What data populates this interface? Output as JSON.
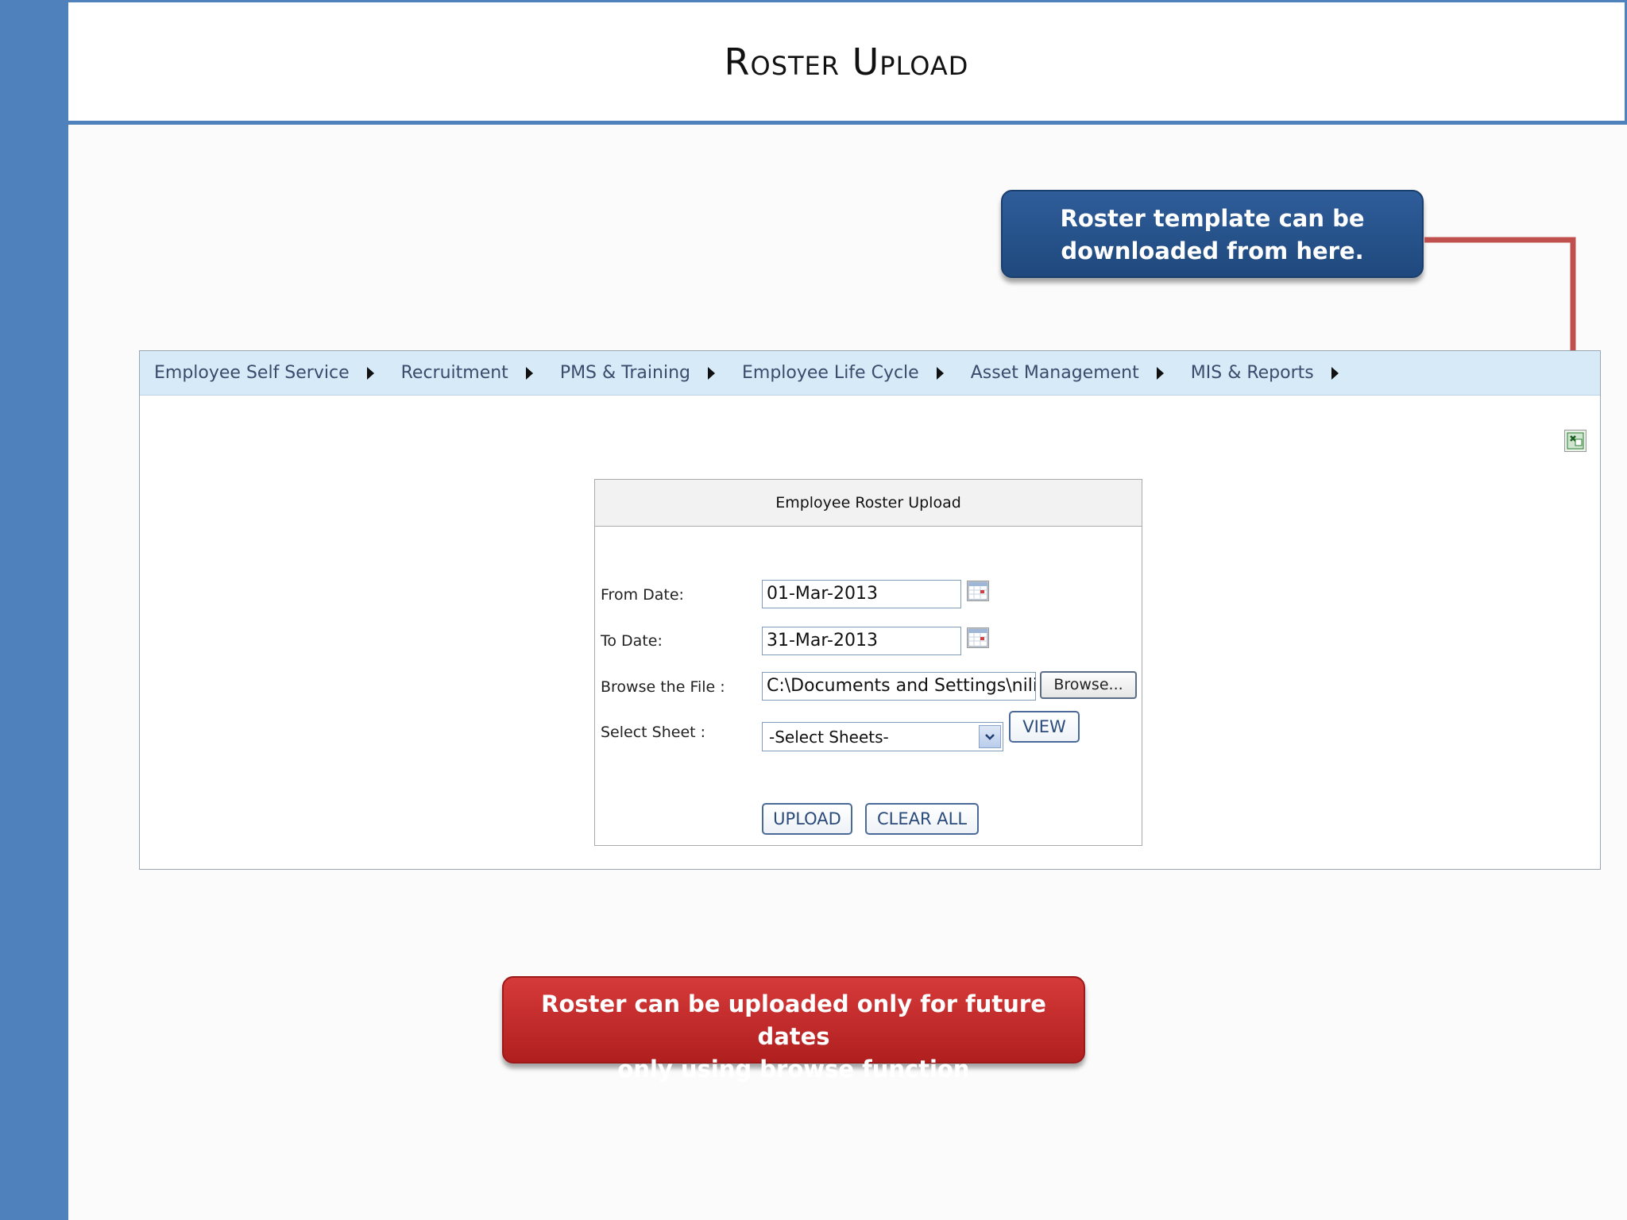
{
  "slide": {
    "title": "Roster Upload"
  },
  "callouts": {
    "template_line1": "Roster template can be",
    "template_line2": "downloaded from here.",
    "future_line1": "Roster can be uploaded only for future dates",
    "future_line2": "only using browse function"
  },
  "menu": {
    "items": [
      {
        "label": "Employee Self Service"
      },
      {
        "label": "Recruitment"
      },
      {
        "label": "PMS & Training"
      },
      {
        "label": "Employee Life Cycle"
      },
      {
        "label": "Asset Management"
      },
      {
        "label": "MIS & Reports"
      }
    ]
  },
  "toolbar": {
    "excel_icon": "excel-download-icon"
  },
  "form": {
    "title": "Employee Roster Upload",
    "from_label": "From Date:",
    "from_value": "01-Mar-2013",
    "to_label": "To Date:",
    "to_value": "31-Mar-2013",
    "file_label": "Browse the File :",
    "file_value": "C:\\Documents and Settings\\nilim",
    "browse_label": "Browse...",
    "sheet_label": "Select Sheet :",
    "sheet_selected": "-Select Sheets-",
    "view_label": "VIEW",
    "upload_label": "UPLOAD",
    "clear_label": "CLEAR ALL"
  },
  "colors": {
    "accent": "#4f81bd",
    "callout_blue": "#1f497d",
    "callout_red": "#c0292b",
    "arrow": "#c0504d"
  }
}
